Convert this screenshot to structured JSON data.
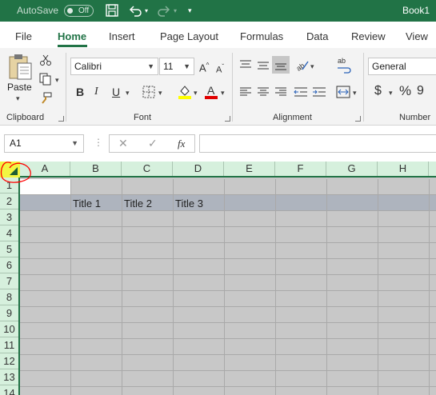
{
  "titlebar": {
    "autosave_label": "AutoSave",
    "autosave_state": "Off",
    "book_title": "Book1"
  },
  "tabs": [
    {
      "label": "File"
    },
    {
      "label": "Home"
    },
    {
      "label": "Insert"
    },
    {
      "label": "Page Layout"
    },
    {
      "label": "Formulas"
    },
    {
      "label": "Data"
    },
    {
      "label": "Review"
    },
    {
      "label": "View"
    }
  ],
  "ribbon": {
    "clipboard": {
      "paste_label": "Paste",
      "group_label": "Clipboard"
    },
    "font": {
      "font_name": "Calibri",
      "font_size": "11",
      "bold": "B",
      "italic": "I",
      "underline": "U",
      "group_label": "Font"
    },
    "alignment": {
      "group_label": "Alignment"
    },
    "number": {
      "format": "General",
      "currency": "$",
      "percent": "%",
      "comma": "9",
      "group_label": "Number"
    }
  },
  "formula_bar": {
    "name_box": "A1",
    "cancel_glyph": "✕",
    "enter_glyph": "✓",
    "fx_label": "fx",
    "content": ""
  },
  "grid": {
    "columns": [
      "A",
      "B",
      "C",
      "D",
      "E",
      "F",
      "G",
      "H"
    ],
    "rows": [
      "1",
      "2",
      "3",
      "4",
      "5",
      "6",
      "7",
      "8",
      "9",
      "10",
      "11",
      "12",
      "13",
      "14"
    ],
    "cells": {
      "B2": "Title 1",
      "C2": "Title 2",
      "D2": "Title 3"
    }
  },
  "colors": {
    "accent": "#217346",
    "header_bg": "#d6f0dd",
    "corner_highlight": "#f2f542",
    "annotation": "#ff0000",
    "cell_bg": "#c8c8c8",
    "header_band": "#aeb4be"
  }
}
